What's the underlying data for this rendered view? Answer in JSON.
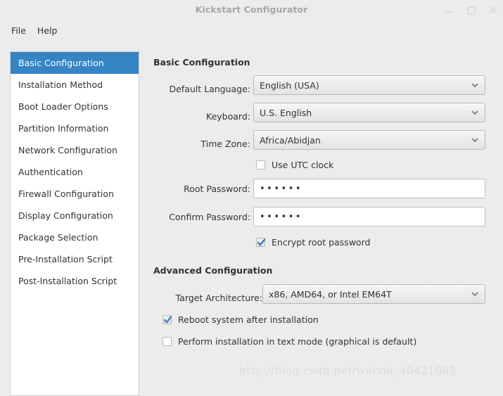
{
  "window": {
    "title": "Kickstart Configurator",
    "controls": [
      {
        "name": "minimize",
        "glyph": "_"
      },
      {
        "name": "maximize",
        "glyph": "□"
      },
      {
        "name": "close",
        "glyph": "×"
      }
    ]
  },
  "menubar": {
    "items": [
      "File",
      "Help"
    ]
  },
  "sidebar": {
    "selected_index": 0,
    "items": [
      "Basic Configuration",
      "Installation Method",
      "Boot Loader Options",
      "Partition Information",
      "Network Configuration",
      "Authentication",
      "Firewall Configuration",
      "Display Configuration",
      "Package Selection",
      "Pre-Installation Script",
      "Post-Installation Script"
    ]
  },
  "basic": {
    "heading": "Basic Configuration",
    "default_language_label": "Default Language:",
    "default_language_value": "English (USA)",
    "keyboard_label": "Keyboard:",
    "keyboard_value": "U.S. English",
    "timezone_label": "Time Zone:",
    "timezone_value": "Africa/Abidjan",
    "use_utc_label": "Use UTC clock",
    "use_utc_checked": false,
    "root_password_label": "Root Password:",
    "root_password_value": "••••••",
    "confirm_password_label": "Confirm Password:",
    "confirm_password_value": "••••••",
    "encrypt_label": "Encrypt root password",
    "encrypt_checked": true
  },
  "advanced": {
    "heading": "Advanced Configuration",
    "target_arch_label": "Target Architecture:",
    "target_arch_value": "x86, AMD64, or Intel EM64T",
    "reboot_label": "Reboot system after installation",
    "reboot_checked": true,
    "textmode_label": "Perform installation in text mode (graphical is default)",
    "textmode_checked": false
  },
  "watermark": {
    "text": "http://blog.csdn.net/weixin_40421085"
  },
  "colors": {
    "accent": "#3584c4",
    "window_bg": "#ececec",
    "check_blue": "#3b7fc4"
  }
}
